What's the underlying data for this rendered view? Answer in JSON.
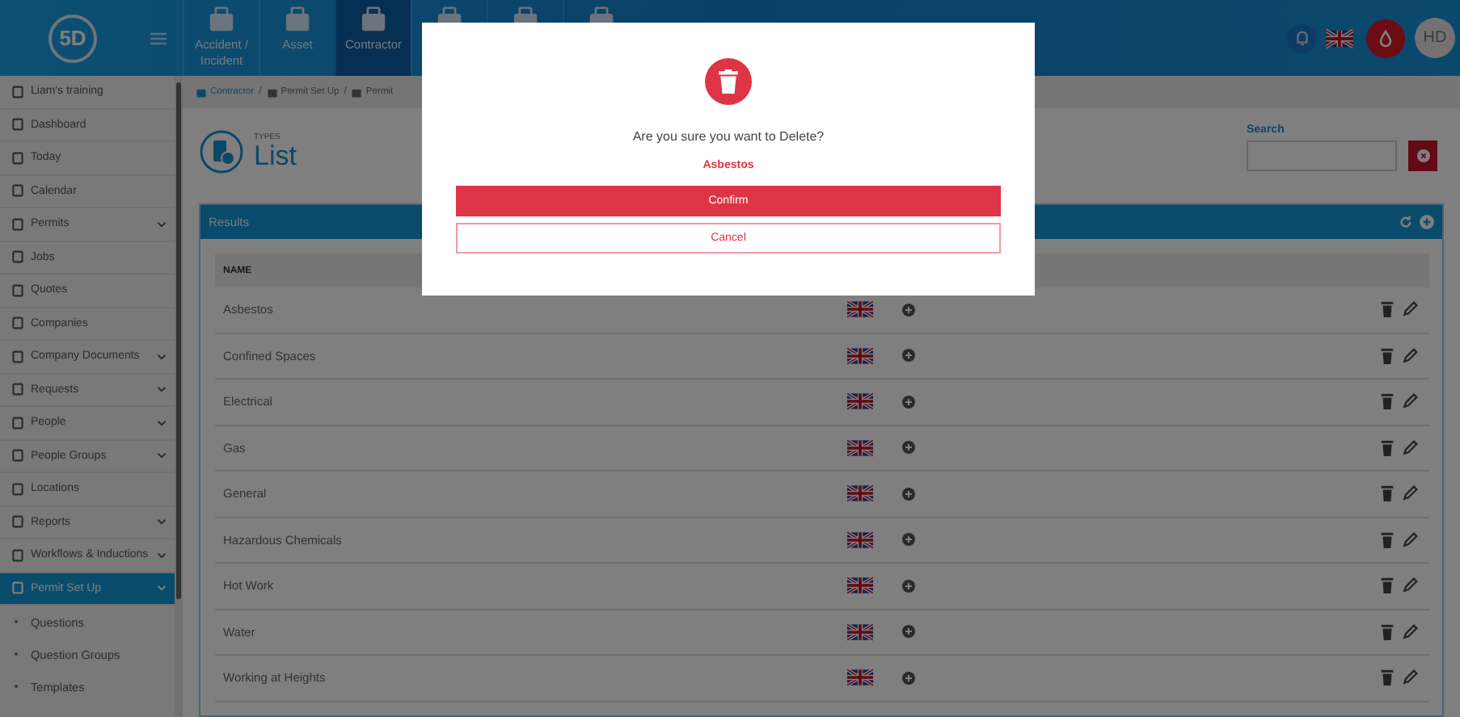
{
  "top_bar": {
    "logo": "5D",
    "modules": [
      {
        "label": "Accident / Incident",
        "selected": false
      },
      {
        "label": "Asset",
        "selected": false
      },
      {
        "label": "Contractor",
        "selected": true
      },
      {
        "selected": false
      },
      {
        "selected": false
      },
      {
        "selected": false
      }
    ],
    "user": {
      "initials": "HD"
    }
  },
  "sidebar": {
    "items": [
      {
        "label": "Liam's training",
        "expandable": false,
        "selected": false
      },
      {
        "label": "Dashboard",
        "expandable": false,
        "selected": false
      },
      {
        "label": "Today",
        "expandable": false,
        "selected": false
      },
      {
        "label": "Calendar",
        "expandable": false,
        "selected": false
      },
      {
        "label": "Permits",
        "expandable": true,
        "selected": false
      },
      {
        "label": "Jobs",
        "expandable": false,
        "selected": false
      },
      {
        "label": "Quotes",
        "expandable": false,
        "selected": false
      },
      {
        "label": "Companies",
        "expandable": false,
        "selected": false
      },
      {
        "label": "Company Documents",
        "expandable": true,
        "selected": false
      },
      {
        "label": "Requests",
        "expandable": true,
        "selected": false
      },
      {
        "label": "People",
        "expandable": true,
        "selected": false
      },
      {
        "label": "People Groups",
        "expandable": true,
        "selected": false
      },
      {
        "label": "Locations",
        "expandable": false,
        "selected": false
      },
      {
        "label": "Reports",
        "expandable": true,
        "selected": false
      },
      {
        "label": "Workflows & Inductions",
        "expandable": true,
        "selected": false
      },
      {
        "label": "Permit Set Up",
        "expandable": true,
        "selected": true,
        "children": [
          {
            "label": "Questions"
          },
          {
            "label": "Question Groups"
          },
          {
            "label": "Templates"
          }
        ]
      }
    ]
  },
  "breadcrumb": {
    "separator": "/",
    "items": [
      "Contractor",
      "Permit Set Up",
      "Permit"
    ]
  },
  "header": {
    "kicker": "TYPES",
    "title": "List"
  },
  "search": {
    "label": "Search"
  },
  "results": {
    "title": "Results",
    "columns": [
      "NAME"
    ],
    "rows": [
      {
        "name": "Asbestos"
      },
      {
        "name": "Confined Spaces"
      },
      {
        "name": "Electrical"
      },
      {
        "name": "Gas"
      },
      {
        "name": "General"
      },
      {
        "name": "Hazardous Chemicals"
      },
      {
        "name": "Hot Work"
      },
      {
        "name": "Water"
      },
      {
        "name": "Working at Heights"
      }
    ]
  },
  "modal": {
    "question": "Are you sure you want to Delete?",
    "item": "Asbestos",
    "confirm": "Confirm",
    "cancel": "Cancel"
  }
}
